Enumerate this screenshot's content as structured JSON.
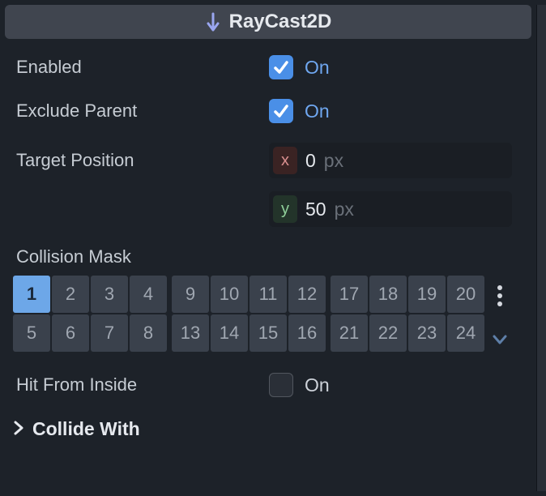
{
  "header": {
    "title": "RayCast2D"
  },
  "props": {
    "enabled": {
      "label": "Enabled",
      "on_text": "On",
      "checked": true
    },
    "exclude_parent": {
      "label": "Exclude Parent",
      "on_text": "On",
      "checked": true
    },
    "target_position": {
      "label": "Target Position",
      "x": {
        "axis": "x",
        "value": "0",
        "unit": "px"
      },
      "y": {
        "axis": "y",
        "value": "50",
        "unit": "px"
      }
    },
    "collision_mask": {
      "label": "Collision Mask",
      "blocks": [
        [
          {
            "n": "1",
            "active": true
          },
          {
            "n": "2"
          },
          {
            "n": "3"
          },
          {
            "n": "4"
          },
          {
            "n": "5"
          },
          {
            "n": "6"
          },
          {
            "n": "7"
          },
          {
            "n": "8"
          }
        ],
        [
          {
            "n": "9"
          },
          {
            "n": "10"
          },
          {
            "n": "11"
          },
          {
            "n": "12"
          },
          {
            "n": "13"
          },
          {
            "n": "14"
          },
          {
            "n": "15"
          },
          {
            "n": "16"
          }
        ],
        [
          {
            "n": "17"
          },
          {
            "n": "18"
          },
          {
            "n": "19"
          },
          {
            "n": "20"
          },
          {
            "n": "21"
          },
          {
            "n": "22"
          },
          {
            "n": "23"
          },
          {
            "n": "24"
          }
        ]
      ]
    },
    "hit_from_inside": {
      "label": "Hit From Inside",
      "on_text": "On",
      "checked": false
    },
    "collide_with": {
      "label": "Collide With"
    }
  }
}
